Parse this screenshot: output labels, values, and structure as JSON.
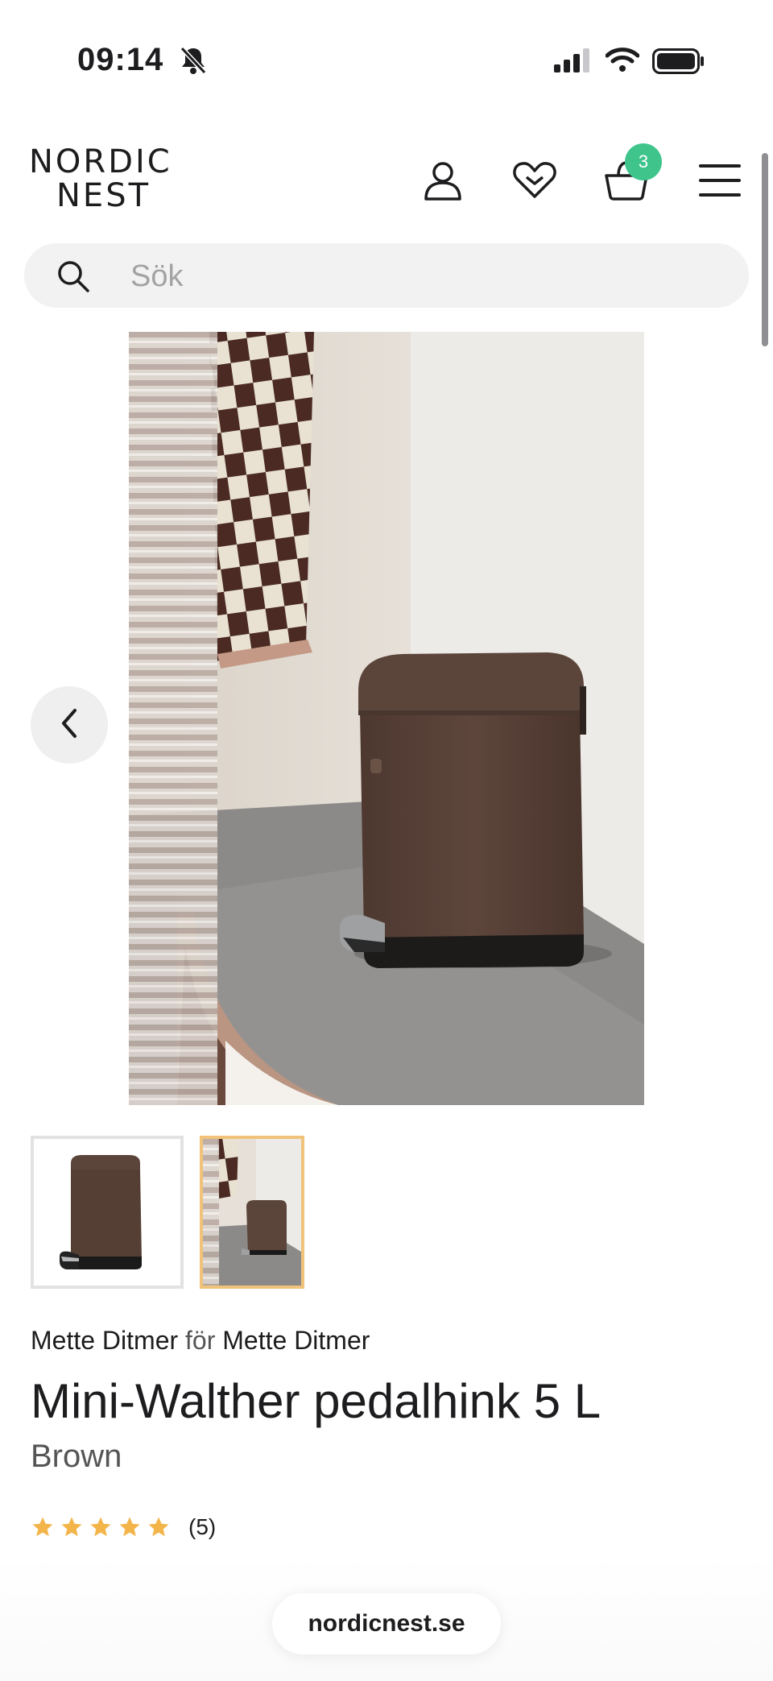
{
  "status_bar": {
    "time": "09:14"
  },
  "header": {
    "logo_line1": "NORDIC",
    "logo_line2": "NEST",
    "cart_count": "3"
  },
  "search": {
    "placeholder": "Sök"
  },
  "product": {
    "brand": "Mette Ditmer",
    "for_word": "för",
    "designer": "Mette Ditmer",
    "title": "Mini-Walther pedalhink 5 L",
    "variant": "Brown",
    "rating": 5,
    "review_count": "(5)"
  },
  "colors": {
    "accent_badge": "#3fc58c",
    "star": "#f3b54a",
    "selected_thumb_border": "#f1c27a",
    "bin_brown": "#5a4138"
  },
  "browser": {
    "url": "nordicnest.se"
  }
}
